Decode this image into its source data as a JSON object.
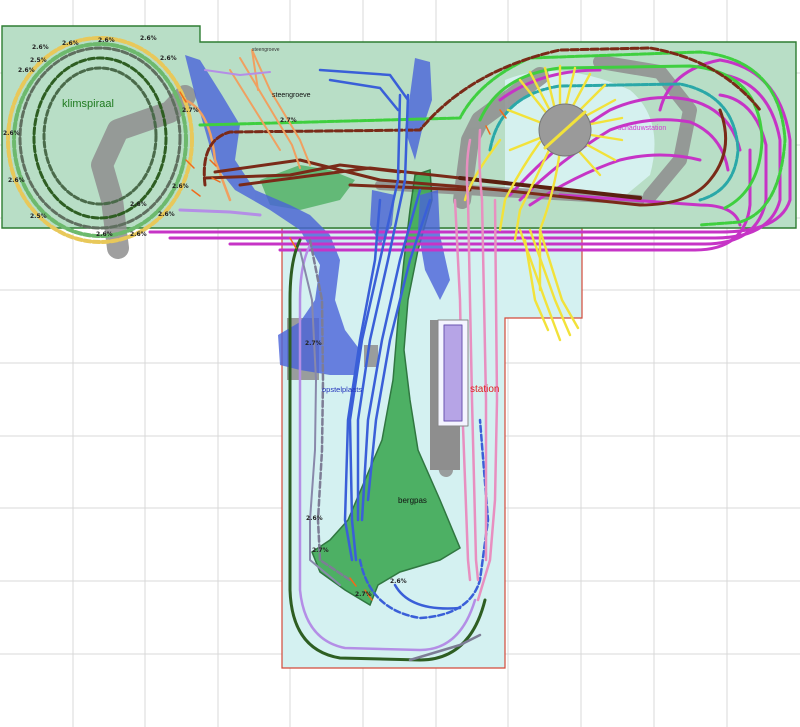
{
  "labels": {
    "klimspiraal": "klimspiraal",
    "steengroeve": "steengroeve",
    "steengroeve_small": "steengroeve",
    "schaduwstation": "schaduwstation",
    "opstelplaats": "opstelplaats",
    "station": "station",
    "bergpas": "bergpas"
  },
  "gradients": {
    "g1": "2.6%",
    "g2": "2.6%",
    "g3": "2.6%",
    "g4": "2.6%",
    "g5": "2.6%",
    "g6": "2.6%",
    "g7": "2.5%",
    "g8": "2.6%",
    "g9": "2.6%",
    "g10": "2.5%",
    "g11": "2.6%",
    "g12": "2.6%",
    "g13": "2.6%",
    "g14": "2.6%",
    "g15": "2.7%",
    "g16": "2.7%",
    "g17": "2.6%",
    "g18": "2.7%",
    "g19": "2.6%",
    "g20": "2.7%",
    "g21": "2.7%",
    "g22": "2.6%"
  },
  "colors": {
    "grid": "#d6d6d6",
    "baseboard_top": "#b9dfc8",
    "baseboard_bottom": "#d6f2f2",
    "board_border_green": "#2e7d32",
    "board_border_red": "#d34a3a",
    "mountain": "#3faa55",
    "water": "#4a63d9",
    "road": "#8a8a8a",
    "track_green": "#3fcf3f",
    "track_darkbrown": "#7a2a18",
    "track_magenta": "#c634c6",
    "track_pink": "#e88fc0",
    "track_blue": "#3a5fd8",
    "track_yellow": "#f2e23a",
    "track_orange": "#f0a060",
    "track_lavender": "#b48ee6",
    "track_darkgreen": "#2e5e22",
    "track_grey": "#7d7d95",
    "label_green": "#1f7a1f",
    "label_magenta": "#d23ad2",
    "label_red": "#e02020",
    "label_blue": "#2233bb",
    "label_black": "#111111"
  }
}
